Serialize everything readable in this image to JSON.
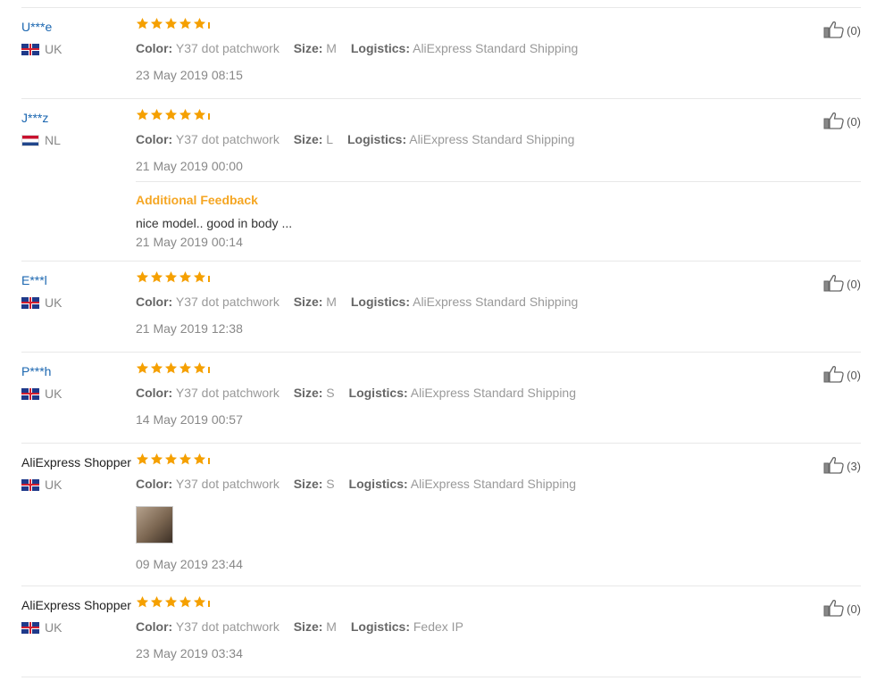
{
  "labels": {
    "color": "Color:",
    "size": "Size:",
    "logistics": "Logistics:",
    "additional_feedback": "Additional Feedback"
  },
  "colors": {
    "username": "#1a66b0",
    "star": "#f5a000",
    "additional_feedback": "#f5a623"
  },
  "reviews": [
    {
      "user": "U***e",
      "country": "UK",
      "flag": "uk-flag-icon",
      "rating": 5,
      "color": "Y37 dot patchwork",
      "size": "M",
      "logistics": "AliExpress Standard Shipping",
      "date": "23 May 2019 08:15",
      "likes": "(0)"
    },
    {
      "user": "J***z",
      "country": "NL",
      "flag": "nl-flag-icon",
      "rating": 5,
      "color": "Y37 dot patchwork",
      "size": "L",
      "logistics": "AliExpress Standard Shipping",
      "date": "21 May 2019 00:00",
      "likes": "(0)",
      "additional": {
        "text": "nice model.. good in body ...",
        "date": "21 May 2019 00:14"
      }
    },
    {
      "user": "E***l",
      "country": "UK",
      "flag": "uk-flag-icon",
      "rating": 5,
      "color": "Y37 dot patchwork",
      "size": "M",
      "logistics": "AliExpress Standard Shipping",
      "date": "21 May 2019 12:38",
      "likes": "(0)"
    },
    {
      "user": "P***h",
      "country": "UK",
      "flag": "uk-flag-icon",
      "rating": 5,
      "color": "Y37 dot patchwork",
      "size": "S",
      "logistics": "AliExpress Standard Shipping",
      "date": "14 May 2019 00:57",
      "likes": "(0)"
    },
    {
      "user": "AliExpress Shopper",
      "country": "UK",
      "flag": "uk-flag-icon",
      "rating": 5,
      "color": "Y37 dot patchwork",
      "size": "S",
      "logistics": "AliExpress Standard Shipping",
      "date": "09 May 2019 23:44",
      "likes": "(3)",
      "has_photo": true
    },
    {
      "user": "AliExpress Shopper",
      "country": "UK",
      "flag": "uk-flag-icon",
      "rating": 5,
      "color": "Y37 dot patchwork",
      "size": "M",
      "logistics": "Fedex IP",
      "date": "23 May 2019 03:34",
      "likes": "(0)"
    }
  ]
}
